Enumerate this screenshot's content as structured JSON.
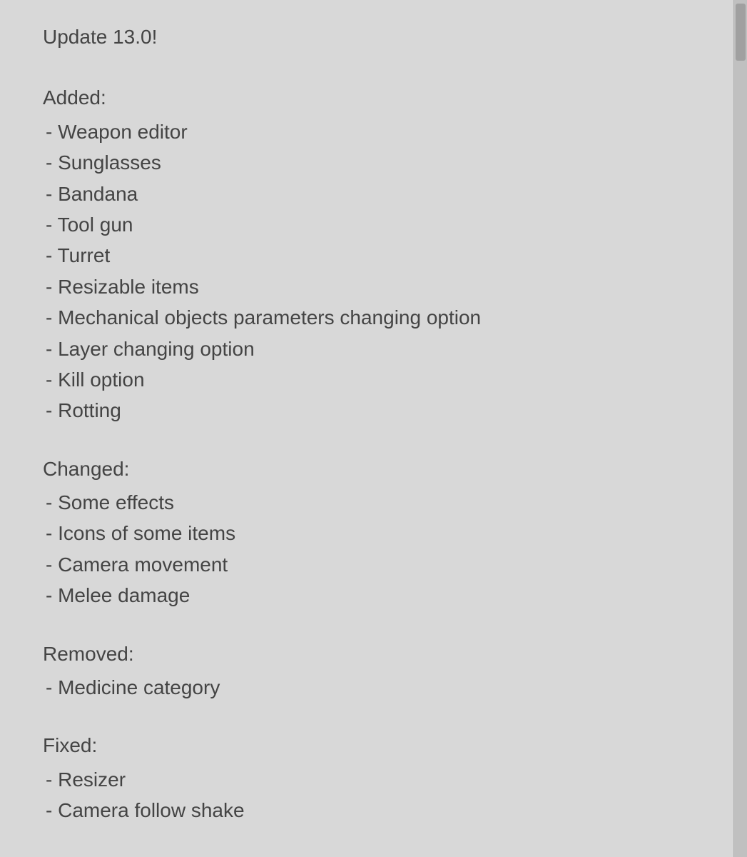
{
  "page": {
    "title": "Update 13.0!",
    "sections": [
      {
        "heading": "Added:",
        "items": [
          "- Weapon editor",
          "- Sunglasses",
          "- Bandana",
          "- Tool gun",
          "- Turret",
          "- Resizable items",
          "- Mechanical objects parameters changing option",
          "- Layer changing option",
          "- Kill option",
          "- Rotting"
        ]
      },
      {
        "heading": "Changed:",
        "items": [
          "- Some effects",
          "- Icons of some items",
          "- Camera movement",
          "- Melee damage"
        ]
      },
      {
        "heading": "Removed:",
        "items": [
          "- Medicine category"
        ]
      },
      {
        "heading": "Fixed:",
        "items": [
          "- Resizer",
          "- Camera follow shake"
        ]
      }
    ]
  }
}
